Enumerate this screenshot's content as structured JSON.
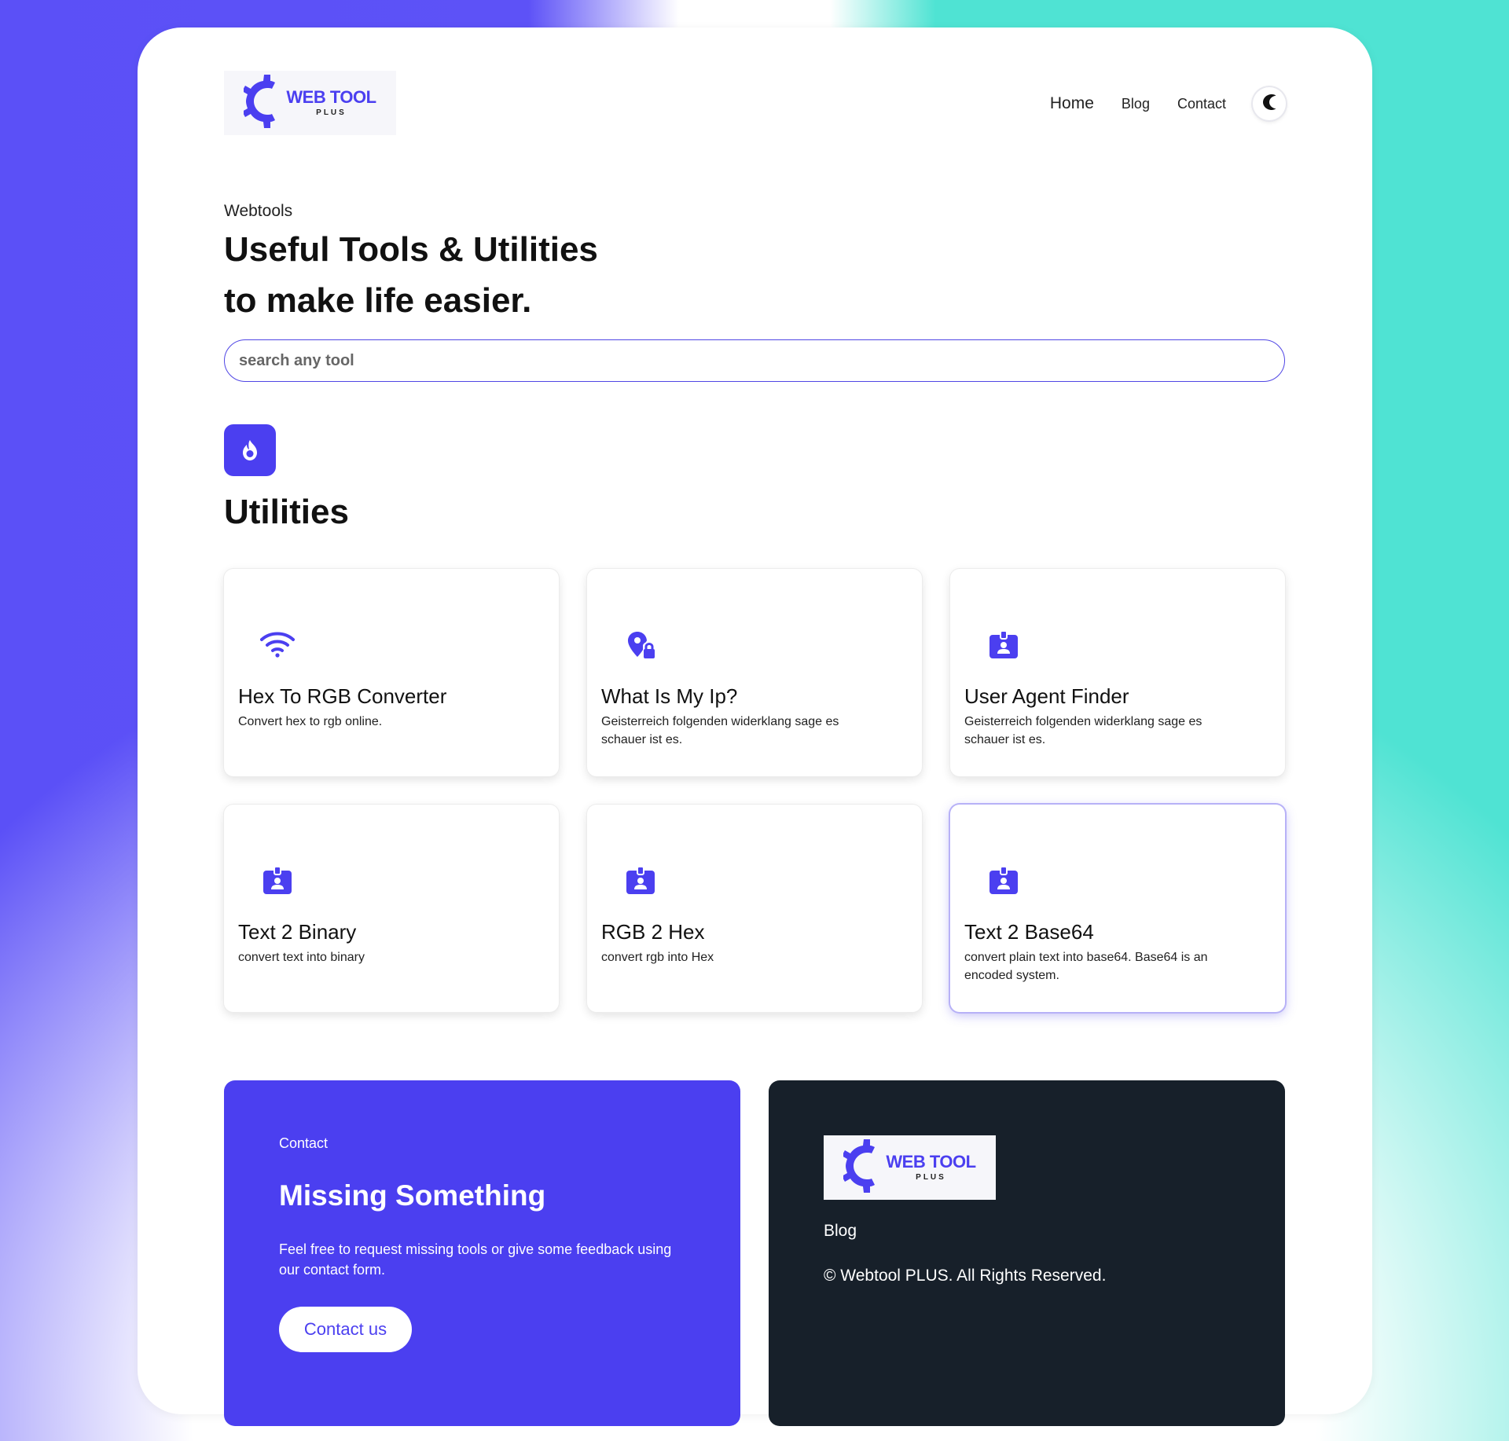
{
  "brand": {
    "logo_main": "WEB TOOL",
    "logo_sub": "PLUS",
    "accent_color": "#4b3ff0",
    "dark_color": "#17202a"
  },
  "nav": {
    "home": "Home",
    "blog": "Blog",
    "contact": "Contact",
    "theme_icon": "moon-icon"
  },
  "hero": {
    "eyebrow": "Webtools",
    "title_line1": "Useful Tools & Utilities",
    "title_line2": "to make life easier.",
    "search_placeholder": "search any tool"
  },
  "section": {
    "icon": "fire-icon",
    "title": "Utilities"
  },
  "tools": [
    {
      "icon": "wifi-icon",
      "title": "Hex To RGB Converter",
      "description": "Convert hex to rgb online."
    },
    {
      "icon": "location-lock-icon",
      "title": "What Is My Ip?",
      "description": "Geisterreich folgenden widerklang sage es schauer ist es."
    },
    {
      "icon": "id-badge-icon",
      "title": "User Agent Finder",
      "description": "Geisterreich folgenden widerklang sage es schauer ist es."
    },
    {
      "icon": "id-badge-icon",
      "title": "Text 2 Binary",
      "description": "convert text into binary"
    },
    {
      "icon": "id-badge-icon",
      "title": "RGB 2 Hex",
      "description": "convert rgb into Hex"
    },
    {
      "icon": "id-badge-icon",
      "title": "Text 2 Base64",
      "description": "convert plain text into base64. Base64 is an encoded system."
    }
  ],
  "contact": {
    "kicker": "Contact",
    "title": "Missing Something",
    "text": "Feel free to request missing tools or give some feedback using our contact form.",
    "button": "Contact us"
  },
  "footer": {
    "blog": "Blog",
    "copyright": "© Webtool PLUS. All Rights Reserved."
  }
}
